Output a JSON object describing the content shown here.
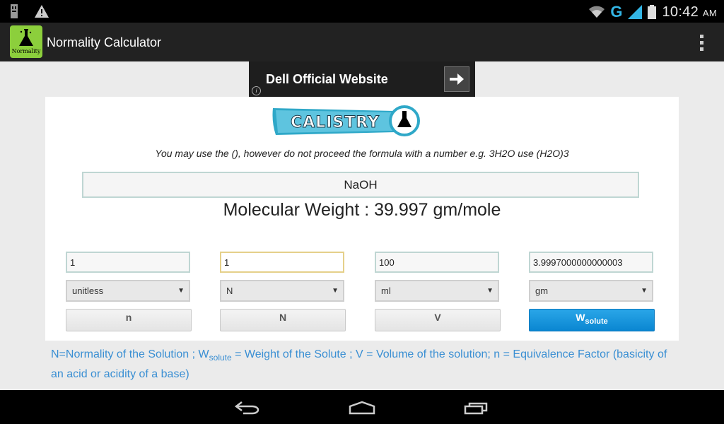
{
  "status_bar": {
    "time": "10:42",
    "ampm": "AM",
    "network_label": "G"
  },
  "action_bar": {
    "app_title": "Normality Calculator",
    "app_icon_label": "Normality"
  },
  "ad": {
    "text": "Dell Official Website",
    "info_glyph": "i"
  },
  "logo_text": "CALISTRY",
  "hint": "You may use the (), however do not proceed the formula with a number e.g. 3H2O use (H2O)3",
  "formula_value": "NaOH",
  "molecular_weight": {
    "label": "Molecular Weight : ",
    "value": "39.997",
    "unit": " gm/mole"
  },
  "columns": [
    {
      "input": "1",
      "unit": "unitless",
      "button": "n"
    },
    {
      "input": "1",
      "unit": "N",
      "button": "N"
    },
    {
      "input": "100",
      "unit": "ml",
      "button": "V"
    },
    {
      "input": "3.9997000000000003",
      "unit": "gm",
      "button_main": "W",
      "button_sub": "solute"
    }
  ],
  "legend": {
    "part1": "N=Normality of the Solution ; W",
    "sub": "solute",
    "part2": " = Weight of the Solute ; V = Volume of the solution; n = Equivalence Factor (basicity of an acid or acidity of a base)"
  },
  "colors": {
    "accent_blue": "#0a86d1",
    "legend_text": "#3a8fd3",
    "app_icon_green": "#8ccf3c"
  }
}
